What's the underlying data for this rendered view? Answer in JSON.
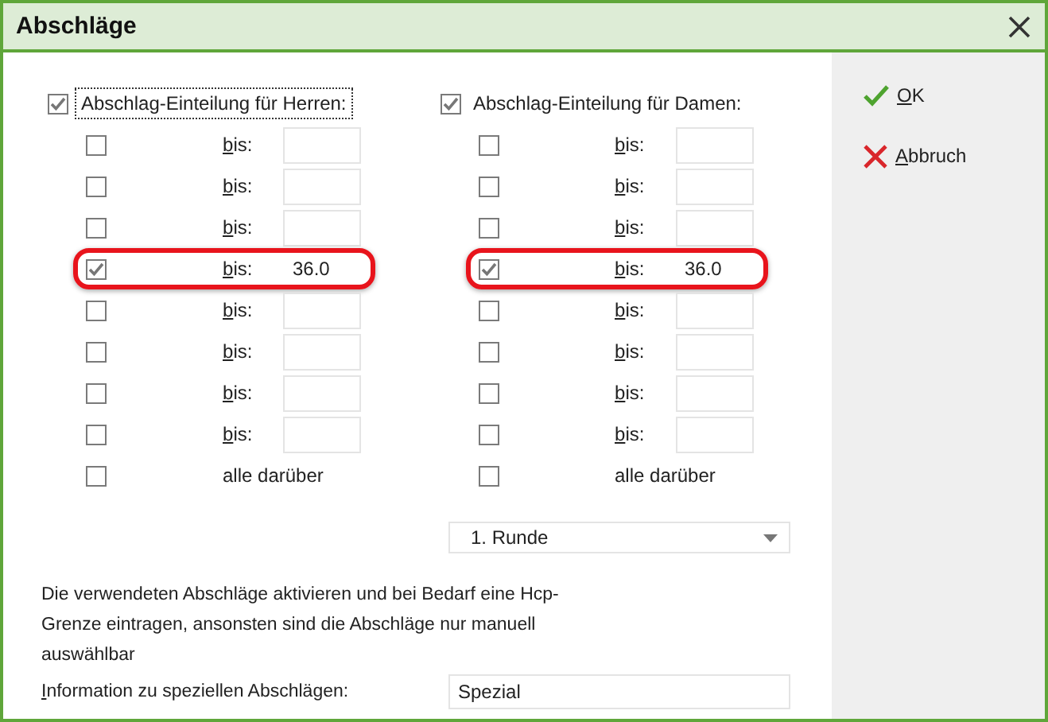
{
  "window": {
    "title": "Abschläge"
  },
  "groups": [
    {
      "label": "Abschlag-Einteilung für Herren:",
      "checked": true,
      "focused": true,
      "rows": [
        {
          "kind": "limit",
          "label": "bis:",
          "checked": false,
          "highlighted": false
        },
        {
          "kind": "limit",
          "label": "bis:",
          "checked": false,
          "highlighted": false
        },
        {
          "kind": "limit",
          "label": "bis:",
          "checked": false,
          "highlighted": false
        },
        {
          "kind": "limit",
          "label": "bis:",
          "value": "36.0",
          "checked": true,
          "highlighted": true
        },
        {
          "kind": "limit",
          "label": "bis:",
          "checked": false,
          "highlighted": false
        },
        {
          "kind": "limit",
          "label": "bis:",
          "checked": false,
          "highlighted": false
        },
        {
          "kind": "limit",
          "label": "bis:",
          "checked": false,
          "highlighted": false
        },
        {
          "kind": "limit",
          "label": "bis:",
          "checked": false,
          "highlighted": false
        },
        {
          "kind": "rest",
          "label": "alle darüber",
          "checked": false,
          "highlighted": false
        }
      ]
    },
    {
      "label": "Abschlag-Einteilung für Damen:",
      "checked": true,
      "focused": false,
      "rows": [
        {
          "kind": "limit",
          "label": "bis:",
          "checked": false,
          "highlighted": false
        },
        {
          "kind": "limit",
          "label": "bis:",
          "checked": false,
          "highlighted": false
        },
        {
          "kind": "limit",
          "label": "bis:",
          "checked": false,
          "highlighted": false
        },
        {
          "kind": "limit",
          "label": "bis:",
          "value": "36.0",
          "checked": true,
          "highlighted": true
        },
        {
          "kind": "limit",
          "label": "bis:",
          "checked": false,
          "highlighted": false
        },
        {
          "kind": "limit",
          "label": "bis:",
          "checked": false,
          "highlighted": false
        },
        {
          "kind": "limit",
          "label": "bis:",
          "checked": false,
          "highlighted": false
        },
        {
          "kind": "limit",
          "label": "bis:",
          "checked": false,
          "highlighted": false
        },
        {
          "kind": "rest",
          "label": "alle darüber",
          "checked": false,
          "highlighted": false
        }
      ]
    }
  ],
  "round_select": {
    "value": "1. Runde"
  },
  "hint": "Die verwendeten Abschläge aktivieren und bei Bedarf eine Hcp-Grenze eintragen, ansonsten sind die Abschläge nur manuell auswählbar",
  "info": {
    "label": "Information zu speziellen Abschlägen:",
    "value": "Spezial"
  },
  "buttons": [
    {
      "kind": "ok",
      "label": "OK"
    },
    {
      "kind": "cancel",
      "label": "Abbruch"
    }
  ]
}
